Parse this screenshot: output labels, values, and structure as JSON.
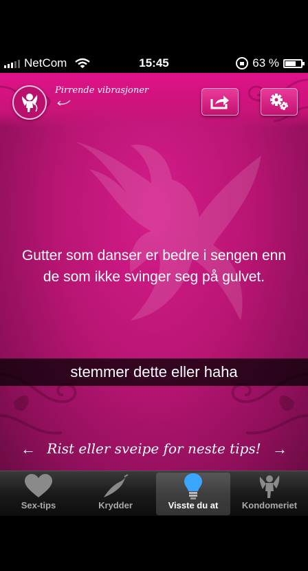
{
  "statusbar": {
    "carrier": "NetCom",
    "time": "15:45",
    "battery": "63 %",
    "battery_level": 0.63
  },
  "header": {
    "tagline": "Pirrende vibrasjoner"
  },
  "tip": {
    "text": "Gutter som danser er bedre i sengen enn de som ikke svinger seg på gulvet."
  },
  "caption": "stemmer dette eller haha",
  "hint": {
    "text": "Rist eller sveipe for neste tips!",
    "left_arrow": "←",
    "right_arrow": "→"
  },
  "tabs": [
    {
      "label": "Sex-tips",
      "icon": "heart-icon"
    },
    {
      "label": "Krydder",
      "icon": "chili-icon"
    },
    {
      "label": "Visste du at",
      "icon": "lightbulb-icon",
      "active": true
    },
    {
      "label": "Kondomeriet",
      "icon": "cupid-icon"
    }
  ]
}
